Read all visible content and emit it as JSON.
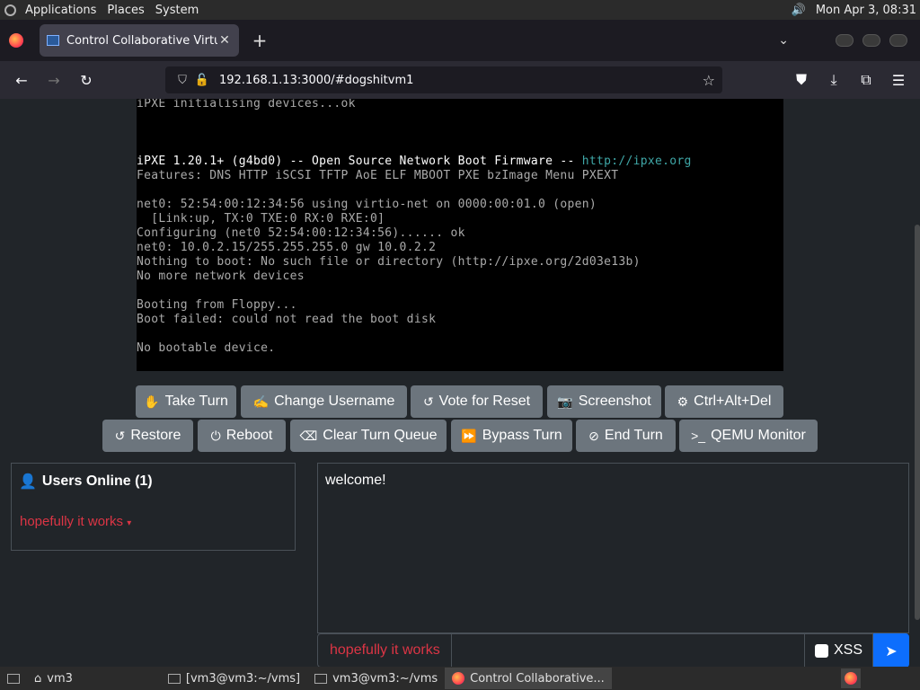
{
  "top_panel": {
    "menus": [
      "Applications",
      "Places",
      "System"
    ],
    "clock": "Mon Apr  3, 08:31"
  },
  "browser": {
    "tab_title": "Control Collaborative Virtual",
    "url_host": "192.168.1.13",
    "url_rest": ":3000/#dogshitvm1"
  },
  "vm_console": {
    "lines": [
      {
        "text": "iPXE initialising devices...ok",
        "style": "normal"
      },
      {
        "text": "",
        "style": "normal"
      },
      {
        "text": "",
        "style": "normal"
      },
      {
        "text": "",
        "style": "normal"
      },
      {
        "text": "iPXE 1.20.1+ (g4bd0) -- Open Source Network Boot Firmware -- ",
        "style": "bright",
        "link": "http://ipxe.org"
      },
      {
        "text": "Features: DNS HTTP iSCSI TFTP AoE ELF MBOOT PXE bzImage Menu PXEXT",
        "style": "normal"
      },
      {
        "text": "",
        "style": "normal"
      },
      {
        "text": "net0: 52:54:00:12:34:56 using virtio-net on 0000:00:01.0 (open)",
        "style": "normal"
      },
      {
        "text": "  [Link:up, TX:0 TXE:0 RX:0 RXE:0]",
        "style": "normal"
      },
      {
        "text": "Configuring (net0 52:54:00:12:34:56)...... ok",
        "style": "normal"
      },
      {
        "text": "net0: 10.0.2.15/255.255.255.0 gw 10.0.2.2",
        "style": "normal"
      },
      {
        "text": "Nothing to boot: No such file or directory (http://ipxe.org/2d03e13b)",
        "style": "normal"
      },
      {
        "text": "No more network devices",
        "style": "normal"
      },
      {
        "text": "",
        "style": "normal"
      },
      {
        "text": "Booting from Floppy...",
        "style": "normal"
      },
      {
        "text": "Boot failed: could not read the boot disk",
        "style": "normal"
      },
      {
        "text": "",
        "style": "normal"
      },
      {
        "text": "No bootable device.",
        "style": "normal"
      }
    ]
  },
  "buttons_row1": [
    {
      "label": "Take Turn",
      "icon": "hand-pointer-icon",
      "glyph": "✋"
    },
    {
      "label": "Change Username",
      "icon": "signature-icon",
      "glyph": "✍"
    },
    {
      "label": "Vote for Reset",
      "icon": "rotate-left-icon",
      "glyph": "↺"
    },
    {
      "label": "Screenshot",
      "icon": "camera-icon",
      "glyph": "📷"
    },
    {
      "label": "Ctrl+Alt+Del",
      "icon": "gear-icon",
      "glyph": "⚙"
    }
  ],
  "buttons_row2": [
    {
      "label": "Restore",
      "icon": "rotate-left-icon",
      "glyph": "↺"
    },
    {
      "label": "Reboot",
      "icon": "power-icon",
      "glyph": "⏻"
    },
    {
      "label": "Clear Turn Queue",
      "icon": "eraser-icon",
      "glyph": "⌫"
    },
    {
      "label": "Bypass Turn",
      "icon": "forward-icon",
      "glyph": "⏩"
    },
    {
      "label": "End Turn",
      "icon": "ban-icon",
      "glyph": "⊘"
    },
    {
      "label": "QEMU Monitor",
      "icon": "terminal-icon",
      "glyph": ">_"
    }
  ],
  "users": {
    "heading": "Users Online (1)",
    "list": [
      "hopefully it works"
    ]
  },
  "chat": {
    "messages": [
      "welcome!"
    ],
    "username": "hopefully it works",
    "xss_label": "XSS"
  },
  "taskbar": {
    "items": [
      "vm3",
      "[vm3@vm3:~/vms]",
      "vm3@vm3:~/vms",
      "Control Collaborative..."
    ]
  },
  "colors": {
    "page_bg": "#212529",
    "button_bg": "#6c757d",
    "username_red": "#dc3545",
    "send_blue": "#0d6efd"
  }
}
